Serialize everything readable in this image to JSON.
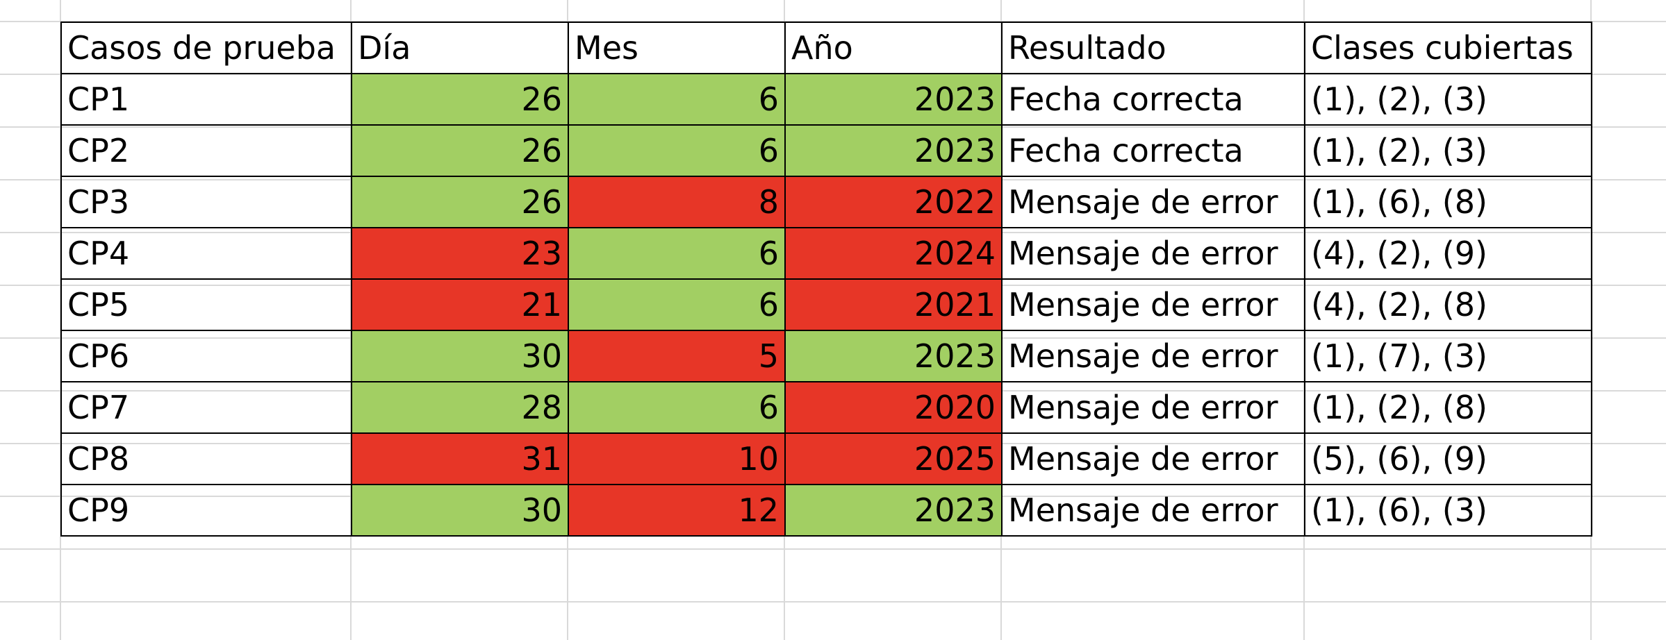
{
  "table": {
    "headers": [
      "Casos de prueba",
      "Día",
      "Mes",
      "Año",
      "Resultado",
      "Clases cubiertas"
    ],
    "rows": [
      {
        "caso": "CP1",
        "dia": "26",
        "mes": "6",
        "anio": "2023",
        "resultado": "Fecha correcta",
        "clases": "(1), (2), (3)",
        "dia_status": "valid",
        "mes_status": "valid",
        "anio_status": "valid"
      },
      {
        "caso": "CP2",
        "dia": "26",
        "mes": "6",
        "anio": "2023",
        "resultado": "Fecha correcta",
        "clases": "(1), (2), (3)",
        "dia_status": "valid",
        "mes_status": "valid",
        "anio_status": "valid"
      },
      {
        "caso": "CP3",
        "dia": "26",
        "mes": "8",
        "anio": "2022",
        "resultado": "Mensaje de error",
        "clases": "(1), (6), (8)",
        "dia_status": "valid",
        "mes_status": "invalid",
        "anio_status": "invalid"
      },
      {
        "caso": "CP4",
        "dia": "23",
        "mes": "6",
        "anio": "2024",
        "resultado": "Mensaje de error",
        "clases": "(4), (2), (9)",
        "dia_status": "invalid",
        "mes_status": "valid",
        "anio_status": "invalid"
      },
      {
        "caso": "CP5",
        "dia": "21",
        "mes": "6",
        "anio": "2021",
        "resultado": "Mensaje de error",
        "clases": "(4), (2), (8)",
        "dia_status": "invalid",
        "mes_status": "valid",
        "anio_status": "invalid"
      },
      {
        "caso": "CP6",
        "dia": "30",
        "mes": "5",
        "anio": "2023",
        "resultado": "Mensaje de error",
        "clases": "(1), (7), (3)",
        "dia_status": "valid",
        "mes_status": "invalid",
        "anio_status": "valid"
      },
      {
        "caso": "CP7",
        "dia": "28",
        "mes": "6",
        "anio": "2020",
        "resultado": "Mensaje de error",
        "clases": "(1), (2), (8)",
        "dia_status": "valid",
        "mes_status": "valid",
        "anio_status": "invalid"
      },
      {
        "caso": "CP8",
        "dia": "31",
        "mes": "10",
        "anio": "2025",
        "resultado": "Mensaje de error",
        "clases": "(5), (6), (9)",
        "dia_status": "invalid",
        "mes_status": "invalid",
        "anio_status": "invalid"
      },
      {
        "caso": "CP9",
        "dia": "30",
        "mes": "12",
        "anio": "2023",
        "resultado": "Mensaje de error",
        "clases": "(1), (6), (3)",
        "dia_status": "valid",
        "mes_status": "invalid",
        "anio_status": "valid"
      }
    ]
  },
  "colors": {
    "valid": "#a2cf63",
    "invalid": "#e73627",
    "gridline": "#d9d9d9",
    "border": "#000000"
  }
}
